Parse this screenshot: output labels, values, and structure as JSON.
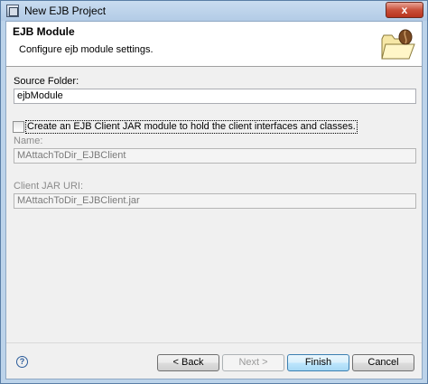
{
  "window": {
    "title": "New EJB Project",
    "close_label": "x"
  },
  "banner": {
    "title": "EJB Module",
    "description": "Configure ejb module settings."
  },
  "form": {
    "source_folder_label": "Source Folder:",
    "source_folder_value": "ejbModule",
    "client_jar_checkbox_label": "Create an EJB Client JAR module to hold the client interfaces and classes.",
    "client_jar_checked": false,
    "name_label": "Name:",
    "name_value": "MAttachToDir_EJBClient",
    "client_jar_uri_label": "Client JAR URI:",
    "client_jar_uri_value": "MAttachToDir_EJBClient.jar"
  },
  "footer": {
    "help_label": "?",
    "back_label": "< Back",
    "next_label": "Next >",
    "finish_label": "Finish",
    "cancel_label": "Cancel"
  },
  "icons": {
    "app": "ejb-project-icon",
    "wizard": "folder-bean-icon",
    "help": "help-icon"
  }
}
